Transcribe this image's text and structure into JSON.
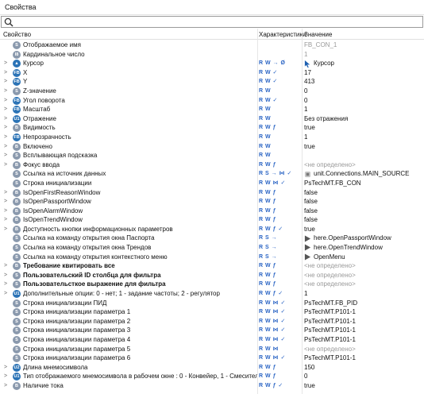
{
  "panel": {
    "title": "Свойства"
  },
  "search": {
    "value": "",
    "icon": "search-icon"
  },
  "columns": {
    "property": "Свойство",
    "characteristics": "Характеристики",
    "value": "Значение"
  },
  "rows": [
    {
      "expander": "",
      "type": "S",
      "icon": "string-type-icon",
      "name": "Отображаемое имя",
      "chars": "",
      "value": "FB_CON_1",
      "placeholder": true,
      "bold": false
    },
    {
      "expander": "",
      "type": "I8",
      "icon": "int-type-icon",
      "name": "Кардинальное число",
      "chars": "",
      "value": "1",
      "placeholder": true,
      "bold": false
    },
    {
      "expander": ">",
      "type": "▲",
      "icon": "cursor-type-icon",
      "name": "Курсор",
      "chars": "R W → Ø",
      "value": "Курсор",
      "placeholder": false,
      "bold": false,
      "value_icon": "cursor-icon"
    },
    {
      "expander": ">",
      "type": "FB",
      "icon": "float-type-icon",
      "name": "X",
      "chars": "R W ✓",
      "value": "17",
      "placeholder": false,
      "bold": false
    },
    {
      "expander": ">",
      "type": "FB",
      "icon": "float-type-icon",
      "name": "Y",
      "chars": "R W ✓",
      "value": "413",
      "placeholder": false,
      "bold": false
    },
    {
      "expander": ">",
      "type": "S",
      "icon": "string-type-icon",
      "name": "Z-значение",
      "chars": "R W",
      "value": "0",
      "placeholder": false,
      "bold": false
    },
    {
      "expander": ">",
      "type": "FB",
      "icon": "float-type-icon",
      "name": "Угол поворота",
      "chars": "R W ✓",
      "value": "0",
      "placeholder": false,
      "bold": false
    },
    {
      "expander": ">",
      "type": "FB",
      "icon": "float-type-icon",
      "name": "Масштаб",
      "chars": "R W",
      "value": "1",
      "placeholder": false,
      "bold": false
    },
    {
      "expander": ">",
      "type": "U1",
      "icon": "enum-type-icon",
      "name": "Отражение",
      "chars": "R W",
      "value": "Без отражения",
      "placeholder": false,
      "bold": false
    },
    {
      "expander": ">",
      "type": "B",
      "icon": "bool-type-icon",
      "name": "Видимость",
      "chars": "R W ƒ",
      "value": "true",
      "placeholder": false,
      "bold": false
    },
    {
      "expander": ">",
      "type": "FB",
      "icon": "float-type-icon",
      "name": "Непрозрачность",
      "chars": "R W",
      "value": "1",
      "placeholder": false,
      "bold": false
    },
    {
      "expander": ">",
      "type": "B",
      "icon": "bool-type-icon",
      "name": "Включено",
      "chars": "R W",
      "value": "true",
      "placeholder": false,
      "bold": false
    },
    {
      "expander": ">",
      "type": "S",
      "icon": "string-type-icon",
      "name": "Всплывающая подсказка",
      "chars": "R W",
      "value": "",
      "placeholder": false,
      "bold": false
    },
    {
      "expander": ">",
      "type": "B",
      "icon": "bool-type-icon",
      "name": "Фокус ввода",
      "chars": "R W ƒ",
      "value": "<не определено>",
      "placeholder": true,
      "bold": false
    },
    {
      "expander": "",
      "type": "S",
      "icon": "string-type-icon",
      "name": "Ссылка на источник данных",
      "chars": "R S → ⋈ ✓",
      "value": "unit.Connections.MAIN_SOURCE",
      "placeholder": false,
      "bold": false,
      "value_icon": "link-icon"
    },
    {
      "expander": "",
      "type": "S",
      "icon": "string-type-icon",
      "name": "Строка инициализации",
      "chars": "R W ⋈ ✓",
      "value": "PsTechMT.FB_CON",
      "placeholder": false,
      "bold": false
    },
    {
      "expander": ">",
      "type": "B",
      "icon": "bool-type-icon",
      "name": "IsOpenFirstReasonWindow",
      "chars": "R W ƒ",
      "value": "false",
      "placeholder": false,
      "bold": false
    },
    {
      "expander": ">",
      "type": "B",
      "icon": "bool-type-icon",
      "name": "IsOpenPassportWindow",
      "chars": "R W ƒ",
      "value": "false",
      "placeholder": false,
      "bold": false
    },
    {
      "expander": ">",
      "type": "B",
      "icon": "bool-type-icon",
      "name": "IsOpenAlarmWindow",
      "chars": "R W ƒ",
      "value": "false",
      "placeholder": false,
      "bold": false
    },
    {
      "expander": ">",
      "type": "B",
      "icon": "bool-type-icon",
      "name": "IsOpenTrendWindow",
      "chars": "R W ƒ",
      "value": "false",
      "placeholder": false,
      "bold": false
    },
    {
      "expander": ">",
      "type": "B",
      "icon": "bool-type-icon",
      "name": "Доступность кнопки информационных параметров",
      "chars": "R W ƒ ✓",
      "value": "true",
      "placeholder": false,
      "bold": false
    },
    {
      "expander": "",
      "type": "S",
      "icon": "string-type-icon",
      "name": "Ссылка на команду открытия окна Паспорта",
      "chars": "R S →",
      "value": "here.OpenPassportWindow",
      "placeholder": false,
      "bold": false,
      "value_icon": "command-icon"
    },
    {
      "expander": "",
      "type": "S",
      "icon": "string-type-icon",
      "name": "Ссылка на команду открытия окна Трендов",
      "chars": "R S →",
      "value": "here.OpenTrendWindow",
      "placeholder": false,
      "bold": false,
      "value_icon": "command-icon"
    },
    {
      "expander": "",
      "type": "S",
      "icon": "string-type-icon",
      "name": "Ссылка на команду открытия контекстного меню",
      "chars": "R S →",
      "value": "OpenMenu",
      "placeholder": false,
      "bold": false,
      "value_icon": "command-icon"
    },
    {
      "expander": ">",
      "type": "B",
      "icon": "bool-type-icon",
      "name": "Требование квитировать все",
      "chars": "R W ƒ",
      "value": "<не определено>",
      "placeholder": true,
      "bold": true
    },
    {
      "expander": ">",
      "type": "S",
      "icon": "string-type-icon",
      "name": "Пользовательский ID столбца для фильтра",
      "chars": "R W ƒ",
      "value": "<не определено>",
      "placeholder": true,
      "bold": true
    },
    {
      "expander": ">",
      "type": "S",
      "icon": "string-type-icon",
      "name": "Пользовательсткое выражение для фильтра",
      "chars": "R W ƒ",
      "value": "<не определено>",
      "placeholder": true,
      "bold": true
    },
    {
      "expander": ">",
      "type": "U1",
      "icon": "enum-type-icon",
      "name": "Дополнительные опции: 0 - нет; 1 - задание частоты; 2 - регулятор",
      "chars": "R W ƒ ✓",
      "value": "1",
      "placeholder": false,
      "bold": false
    },
    {
      "expander": "",
      "type": "S",
      "icon": "string-type-icon",
      "name": "Строка инициализации ПИД",
      "chars": "R W ⋈ ✓",
      "value": "PsTechMT.FB_PID",
      "placeholder": false,
      "bold": false
    },
    {
      "expander": "",
      "type": "S",
      "icon": "string-type-icon",
      "name": "Строка инициализации параметра 1",
      "chars": "R W ⋈ ✓",
      "value": "PsTechMT.P101-1",
      "placeholder": false,
      "bold": false
    },
    {
      "expander": "",
      "type": "S",
      "icon": "string-type-icon",
      "name": "Строка инициализации параметра 2",
      "chars": "R W ⋈ ✓",
      "value": "PsTechMT.P101-1",
      "placeholder": false,
      "bold": false
    },
    {
      "expander": "",
      "type": "S",
      "icon": "string-type-icon",
      "name": "Строка инициализации параметра 3",
      "chars": "R W ⋈ ✓",
      "value": "PsTechMT.P101-1",
      "placeholder": false,
      "bold": false
    },
    {
      "expander": "",
      "type": "S",
      "icon": "string-type-icon",
      "name": "Строка инициализации параметра 4",
      "chars": "R W ⋈ ✓",
      "value": "PsTechMT.P101-1",
      "placeholder": false,
      "bold": false
    },
    {
      "expander": "",
      "type": "S",
      "icon": "string-type-icon",
      "name": "Строка инициализации параметра 5",
      "chars": "R W ⋈",
      "value": "<не определено>",
      "placeholder": true,
      "bold": false
    },
    {
      "expander": "",
      "type": "S",
      "icon": "string-type-icon",
      "name": "Строка инициализации параметра 6",
      "chars": "R W ⋈ ✓",
      "value": "PsTechMT.P101-1",
      "placeholder": false,
      "bold": false
    },
    {
      "expander": ">",
      "type": "U2",
      "icon": "enum-type-icon",
      "name": "Длина мнемосимвола",
      "chars": "R W ƒ",
      "value": "150",
      "placeholder": false,
      "bold": false
    },
    {
      "expander": ">",
      "type": "U1",
      "icon": "enum-type-icon",
      "name": "Тип отображаемого мнемосимвола в рабочем окне : 0 - Конвейер, 1 - Смеситель №1, 2- ...",
      "chars": "R W ƒ",
      "value": "0",
      "placeholder": false,
      "bold": false
    },
    {
      "expander": ">",
      "type": "B",
      "icon": "bool-type-icon",
      "name": "Наличие тока",
      "chars": "R W ƒ ✓",
      "value": "true",
      "placeholder": false,
      "bold": false
    }
  ]
}
